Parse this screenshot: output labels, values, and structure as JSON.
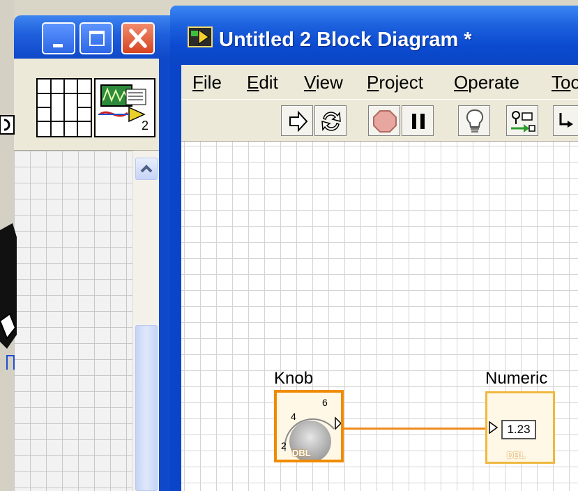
{
  "main_window": {
    "title": "Untitled 2 Block Diagram *",
    "menu": [
      {
        "accel": "F",
        "rest": "ile"
      },
      {
        "accel": "E",
        "rest": "dit"
      },
      {
        "accel": "V",
        "rest": "iew"
      },
      {
        "accel": "P",
        "rest": "roject"
      },
      {
        "accel": "O",
        "rest": "perate"
      },
      {
        "accel": "To",
        "rest": "o"
      }
    ],
    "toolbar": [
      "run-arrow-icon",
      "run-continuously-icon",
      "abort-icon",
      "pause-icon",
      "highlight-execution-icon",
      "retain-wire-values-icon",
      "step-into-icon"
    ]
  },
  "left_window": {
    "vi_icon_number": "2"
  },
  "diagram": {
    "knob": {
      "label": "Knob",
      "type": "DBL",
      "dial_marks": [
        "2",
        "4",
        "6"
      ]
    },
    "numeric": {
      "label": "Numeric",
      "type": "DBL",
      "value": "1.23"
    },
    "wire_color": "#ef8c1b",
    "knob_border_color": "#f08a00",
    "numeric_border_color": "#f0b840"
  }
}
